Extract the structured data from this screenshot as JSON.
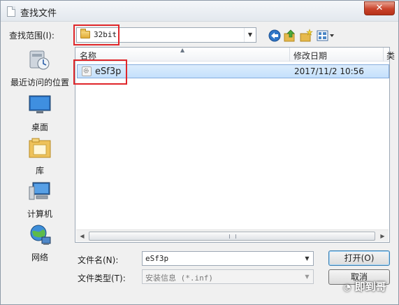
{
  "window": {
    "title": "查找文件",
    "close_glyph": "✕"
  },
  "lookin": {
    "label": "查找范围(I):",
    "value": "32bit",
    "folder_icon": "folder-icon"
  },
  "toolbar": {
    "back_icon": "back-arrow-icon",
    "up_icon": "up-folder-icon",
    "newfolder_icon": "new-folder-icon",
    "view_icon": "view-menu-icon"
  },
  "places": [
    {
      "label": "最近访问的位置",
      "icon": "recent-places-icon"
    },
    {
      "label": "桌面",
      "icon": "desktop-icon"
    },
    {
      "label": "库",
      "icon": "libraries-icon"
    },
    {
      "label": "计算机",
      "icon": "computer-icon"
    },
    {
      "label": "网络",
      "icon": "network-icon"
    }
  ],
  "listview": {
    "columns": [
      "名称",
      "修改日期",
      "类"
    ],
    "rows": [
      {
        "name": "eSf3p",
        "date": "2017/11/2 10:56",
        "selected": true,
        "icon": "inf-file-icon"
      }
    ]
  },
  "filename": {
    "label": "文件名(N):",
    "value": "eSf3p"
  },
  "filetype": {
    "label": "文件类型(T):",
    "value": "安装信息 (*.inf)"
  },
  "buttons": {
    "open": "打开(O)",
    "cancel": "取消"
  },
  "watermark": {
    "text": "即到哥"
  },
  "colors": {
    "highlight": "#e0262a",
    "selection": "#c4e0fc"
  }
}
